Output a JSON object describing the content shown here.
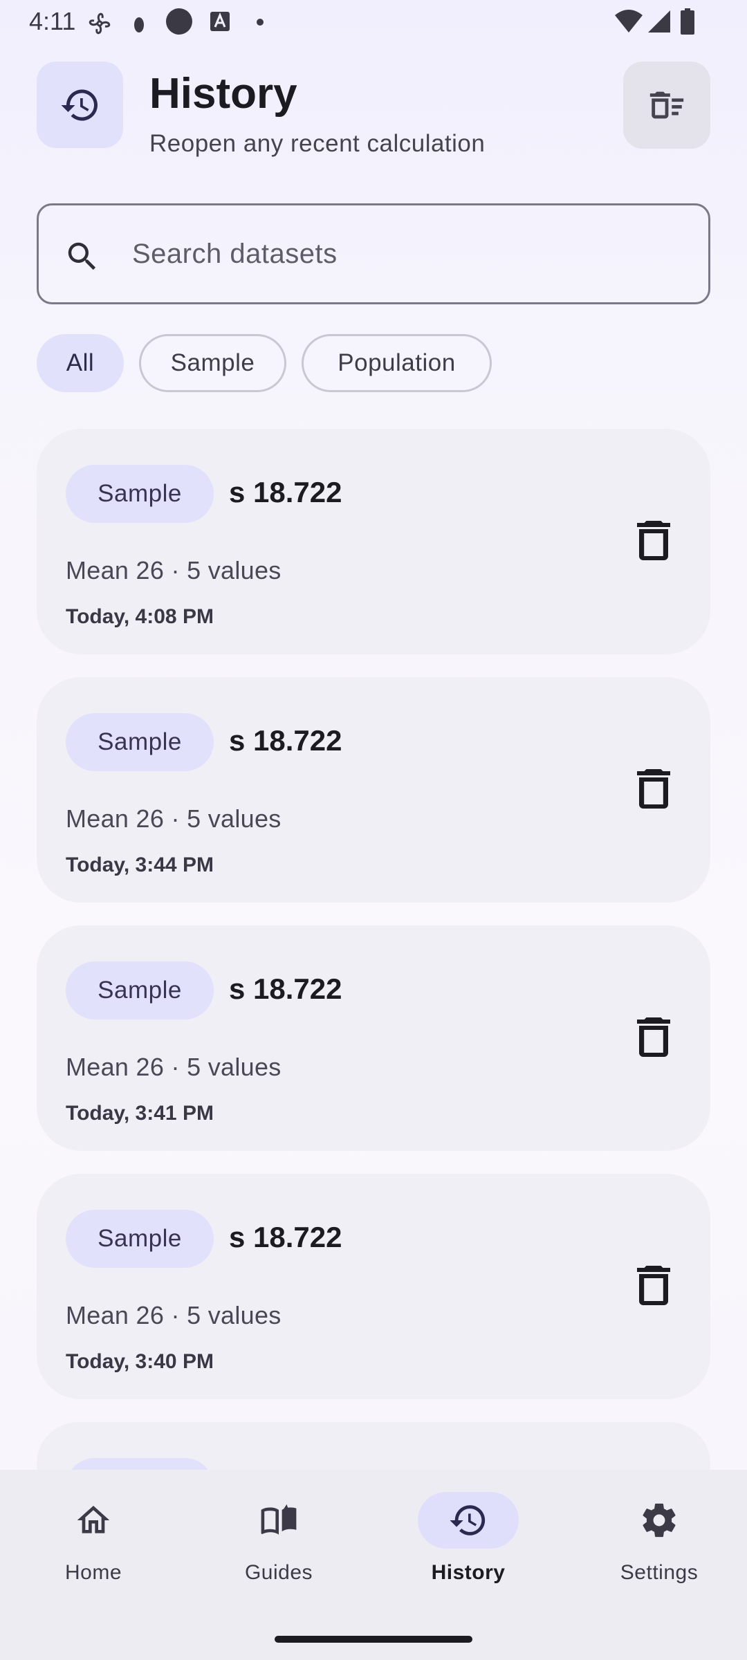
{
  "status_bar": {
    "time": "4:11"
  },
  "header": {
    "title": "History",
    "subtitle": "Reopen any recent calculation",
    "icon": "history-icon",
    "clear_icon": "clear-all-icon"
  },
  "search": {
    "placeholder": "Search datasets",
    "value": ""
  },
  "filters": [
    {
      "label": "All",
      "selected": true
    },
    {
      "label": "Sample",
      "selected": false
    },
    {
      "label": "Population",
      "selected": false
    }
  ],
  "entries": [
    {
      "type": "Sample",
      "value": "s 18.722",
      "meta": "Mean 26 · 5 values",
      "time": "Today, 4:08 PM"
    },
    {
      "type": "Sample",
      "value": "s 18.722",
      "meta": "Mean 26 · 5 values",
      "time": "Today, 3:44 PM"
    },
    {
      "type": "Sample",
      "value": "s 18.722",
      "meta": "Mean 26 · 5 values",
      "time": "Today, 3:41 PM"
    },
    {
      "type": "Sample",
      "value": "s 18.722",
      "meta": "Mean 26 · 5 values",
      "time": "Today, 3:40 PM"
    }
  ],
  "nav": [
    {
      "label": "Home",
      "icon": "home-icon",
      "active": false
    },
    {
      "label": "Guides",
      "icon": "book-icon",
      "active": false
    },
    {
      "label": "History",
      "icon": "history-icon",
      "active": true
    },
    {
      "label": "Settings",
      "icon": "gear-icon",
      "active": false
    }
  ],
  "colors": {
    "accent_container": "#e2e1fb",
    "card_bg": "#f1eff6",
    "nav_bg": "#eeecf3",
    "icon_dark": "#2b2950"
  }
}
